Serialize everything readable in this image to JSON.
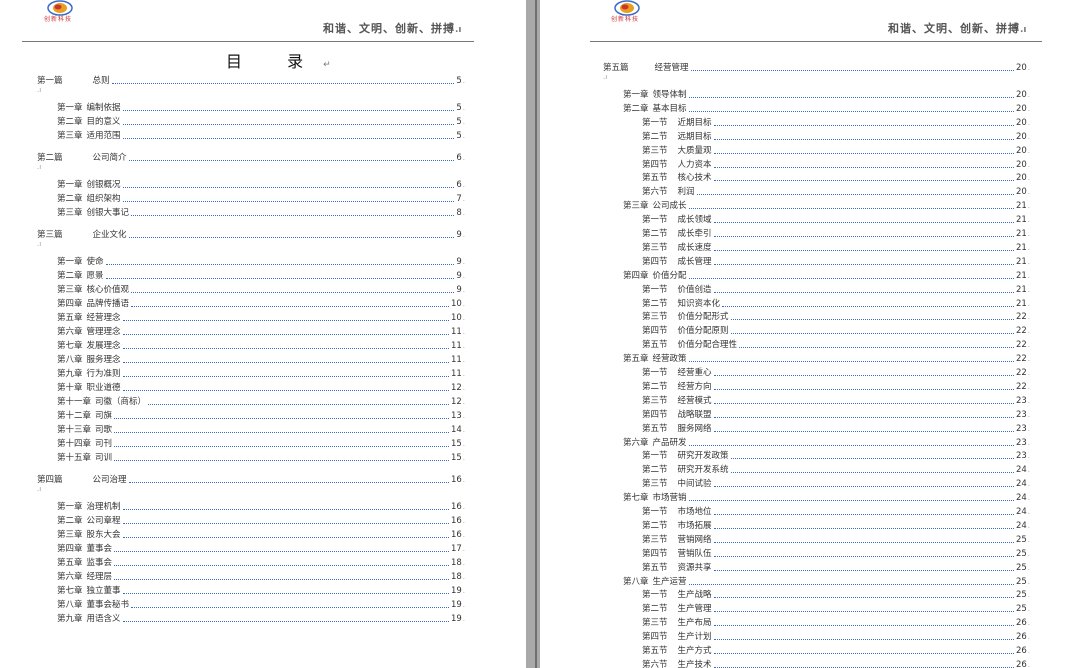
{
  "header": {
    "slogan": "和谐、文明、创新、拼搏",
    "logo_text": "创新科技"
  },
  "left_page": {
    "toc_title": "目 录",
    "entries": [
      {
        "level": 1,
        "num": "第一篇",
        "title": "总则",
        "page": "5"
      },
      {
        "level": 2,
        "num": "第一章",
        "title": "编制依据",
        "page": "5"
      },
      {
        "level": 2,
        "num": "第二章",
        "title": "目的意义",
        "page": "5"
      },
      {
        "level": 2,
        "num": "第三章",
        "title": "适用范围",
        "page": "5"
      },
      {
        "level": 1,
        "num": "第二篇",
        "title": "公司简介",
        "page": "6"
      },
      {
        "level": 2,
        "num": "第一章",
        "title": "创银概况",
        "page": "6"
      },
      {
        "level": 2,
        "num": "第二章",
        "title": "组织架构",
        "page": "7"
      },
      {
        "level": 2,
        "num": "第三章",
        "title": "创银大事记",
        "page": "8"
      },
      {
        "level": 1,
        "num": "第三篇",
        "title": "企业文化",
        "page": "9"
      },
      {
        "level": 2,
        "num": "第一章",
        "title": "使命",
        "page": "9"
      },
      {
        "level": 2,
        "num": "第二章",
        "title": "愿景",
        "page": "9"
      },
      {
        "level": 2,
        "num": "第三章",
        "title": "核心价值观",
        "page": "9"
      },
      {
        "level": 2,
        "num": "第四章",
        "title": "品牌传播语",
        "page": "10"
      },
      {
        "level": 2,
        "num": "第五章",
        "title": "经营理念",
        "page": "10"
      },
      {
        "level": 2,
        "num": "第六章",
        "title": "管理理念",
        "page": "11"
      },
      {
        "level": 2,
        "num": "第七章",
        "title": "发展理念",
        "page": "11"
      },
      {
        "level": 2,
        "num": "第八章",
        "title": "服务理念",
        "page": "11"
      },
      {
        "level": 2,
        "num": "第九章",
        "title": "行为准则",
        "page": "11"
      },
      {
        "level": 2,
        "num": "第十章",
        "title": "职业道德",
        "page": "12"
      },
      {
        "level": 2,
        "num": "第十一章",
        "title": "司徽（商标）",
        "page": "12"
      },
      {
        "level": 2,
        "num": "第十二章",
        "title": "司旗",
        "page": "13"
      },
      {
        "level": 2,
        "num": "第十三章",
        "title": "司歌",
        "page": "14"
      },
      {
        "level": 2,
        "num": "第十四章",
        "title": "司刊",
        "page": "15"
      },
      {
        "level": 2,
        "num": "第十五章",
        "title": "司训",
        "page": "15"
      },
      {
        "level": 1,
        "num": "第四篇",
        "title": "公司治理",
        "page": "16"
      },
      {
        "level": 2,
        "num": "第一章",
        "title": "治理机制",
        "page": "16"
      },
      {
        "level": 2,
        "num": "第二章",
        "title": "公司章程",
        "page": "16"
      },
      {
        "level": 2,
        "num": "第三章",
        "title": "股东大会",
        "page": "16"
      },
      {
        "level": 2,
        "num": "第四章",
        "title": "董事会",
        "page": "17"
      },
      {
        "level": 2,
        "num": "第五章",
        "title": "监事会",
        "page": "18"
      },
      {
        "level": 2,
        "num": "第六章",
        "title": "经理层",
        "page": "18"
      },
      {
        "level": 2,
        "num": "第七章",
        "title": "独立董事",
        "page": "19"
      },
      {
        "level": 2,
        "num": "第八章",
        "title": "董事会秘书",
        "page": "19"
      },
      {
        "level": 2,
        "num": "第九章",
        "title": "用语含义",
        "page": "19"
      }
    ]
  },
  "right_page": {
    "entries": [
      {
        "level": 1,
        "num": "第五篇",
        "title": "经营管理",
        "page": "20"
      },
      {
        "level": 2,
        "num": "第一章",
        "title": "领导体制",
        "page": "20"
      },
      {
        "level": 2,
        "num": "第二章",
        "title": "基本目标",
        "page": "20"
      },
      {
        "level": 3,
        "num": "第一节",
        "title": "近期目标",
        "page": "20"
      },
      {
        "level": 3,
        "num": "第二节",
        "title": "远期目标",
        "page": "20"
      },
      {
        "level": 3,
        "num": "第三节",
        "title": "大质量观",
        "page": "20"
      },
      {
        "level": 3,
        "num": "第四节",
        "title": "人力资本",
        "page": "20"
      },
      {
        "level": 3,
        "num": "第五节",
        "title": "核心技术",
        "page": "20"
      },
      {
        "level": 3,
        "num": "第六节",
        "title": "利润",
        "page": "20"
      },
      {
        "level": 2,
        "num": "第三章",
        "title": "公司成长",
        "page": "21"
      },
      {
        "level": 3,
        "num": "第一节",
        "title": "成长领域",
        "page": "21"
      },
      {
        "level": 3,
        "num": "第二节",
        "title": "成长牵引",
        "page": "21"
      },
      {
        "level": 3,
        "num": "第三节",
        "title": "成长速度",
        "page": "21"
      },
      {
        "level": 3,
        "num": "第四节",
        "title": "成长管理",
        "page": "21"
      },
      {
        "level": 2,
        "num": "第四章",
        "title": "价值分配",
        "page": "21"
      },
      {
        "level": 3,
        "num": "第一节",
        "title": "价值创造",
        "page": "21"
      },
      {
        "level": 3,
        "num": "第二节",
        "title": "知识资本化",
        "page": "21"
      },
      {
        "level": 3,
        "num": "第三节",
        "title": "价值分配形式",
        "page": "22"
      },
      {
        "level": 3,
        "num": "第四节",
        "title": "价值分配原则",
        "page": "22"
      },
      {
        "level": 3,
        "num": "第五节",
        "title": "价值分配合理性",
        "page": "22"
      },
      {
        "level": 2,
        "num": "第五章",
        "title": "经营政策",
        "page": "22"
      },
      {
        "level": 3,
        "num": "第一节",
        "title": "经营重心",
        "page": "22"
      },
      {
        "level": 3,
        "num": "第二节",
        "title": "经营方向",
        "page": "22"
      },
      {
        "level": 3,
        "num": "第三节",
        "title": "经营模式",
        "page": "23"
      },
      {
        "level": 3,
        "num": "第四节",
        "title": "战略联盟",
        "page": "23"
      },
      {
        "level": 3,
        "num": "第五节",
        "title": "服务网络",
        "page": "23"
      },
      {
        "level": 2,
        "num": "第六章",
        "title": "产品研发",
        "page": "23"
      },
      {
        "level": 3,
        "num": "第一节",
        "title": "研究开发政策",
        "page": "23"
      },
      {
        "level": 3,
        "num": "第二节",
        "title": "研究开发系统",
        "page": "24"
      },
      {
        "level": 3,
        "num": "第三节",
        "title": "中间试验",
        "page": "24"
      },
      {
        "level": 2,
        "num": "第七章",
        "title": "市场营销",
        "page": "24"
      },
      {
        "level": 3,
        "num": "第一节",
        "title": "市场地位",
        "page": "24"
      },
      {
        "level": 3,
        "num": "第二节",
        "title": "市场拓展",
        "page": "24"
      },
      {
        "level": 3,
        "num": "第三节",
        "title": "营销网络",
        "page": "25"
      },
      {
        "level": 3,
        "num": "第四节",
        "title": "营销队伍",
        "page": "25"
      },
      {
        "level": 3,
        "num": "第五节",
        "title": "资源共享",
        "page": "25"
      },
      {
        "level": 2,
        "num": "第八章",
        "title": "生产运营",
        "page": "25"
      },
      {
        "level": 3,
        "num": "第一节",
        "title": "生产战略",
        "page": "25"
      },
      {
        "level": 3,
        "num": "第二节",
        "title": "生产管理",
        "page": "25"
      },
      {
        "level": 3,
        "num": "第三节",
        "title": "生产布局",
        "page": "26"
      },
      {
        "level": 3,
        "num": "第四节",
        "title": "生产计划",
        "page": "26"
      },
      {
        "level": 3,
        "num": "第五节",
        "title": "生产方式",
        "page": "26"
      },
      {
        "level": 3,
        "num": "第六节",
        "title": "生产技术",
        "page": "26"
      }
    ]
  },
  "colors": {
    "leader_dots": "#3a6bc8",
    "logo_red": "#c33",
    "page_bg": "#ffffff",
    "workspace_bg": "#a0a0a0"
  }
}
